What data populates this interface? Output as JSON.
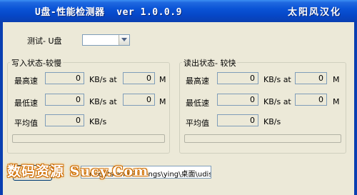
{
  "window": {
    "title": "U盘-性能检测器  ver 1.0.0.9",
    "brand": "太阳风汉化"
  },
  "test": {
    "label": "测试- U盘",
    "selected": ""
  },
  "write": {
    "title": "写入状态-较慢",
    "max_label": "最高速",
    "min_label": "最低速",
    "avg_label": "平均值",
    "max_value": "0",
    "max_at": "0",
    "min_value": "0",
    "min_at": "0",
    "avg_value": "0",
    "unit_kbs_at": "KB/s  at",
    "unit_m": "M",
    "unit_kbs": "KB/s",
    "progress": 0
  },
  "read": {
    "title": "读出状态- 较快",
    "max_label": "最高速",
    "min_label": "最低速",
    "avg_label": "平均值",
    "max_value": "0",
    "max_at": "0",
    "min_value": "0",
    "min_at": "0",
    "avg_value": "0",
    "unit_kbs_at": "KB/s  at",
    "unit_m": "M",
    "unit_kbs": "KB/s",
    "progress": 0
  },
  "path": {
    "value": "cuments and Settings\\ying\\桌面\\udiskte"
  },
  "watermark": "数码资源 Sucy.Com"
}
